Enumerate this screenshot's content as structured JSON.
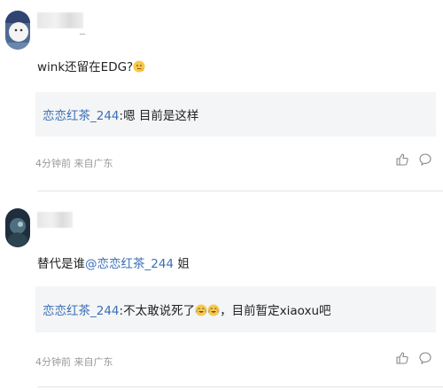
{
  "comments": [
    {
      "username_tail": "_",
      "content_text": "wink还留在EDG?",
      "content_emoji": "thinking-emoji",
      "reply": {
        "user": "恋恋红茶_244",
        "sep": ":",
        "text": "嗯 目前是这样"
      },
      "meta": "4分钟前 来自广东"
    },
    {
      "username_tail": "",
      "content_prefix": "替代是谁",
      "content_mention": "@恋恋红茶_244",
      "content_suffix": " 姐",
      "reply": {
        "user": "恋恋红茶_244",
        "sep": ":",
        "text_before": "不太敢说死了",
        "emoji": "joy-emoji",
        "text_after": "，目前暂定xiaoxu吧"
      },
      "meta": "4分钟前 来自广东"
    }
  ],
  "icons": {
    "like": "thumbs-up-icon",
    "reply": "comment-icon"
  }
}
